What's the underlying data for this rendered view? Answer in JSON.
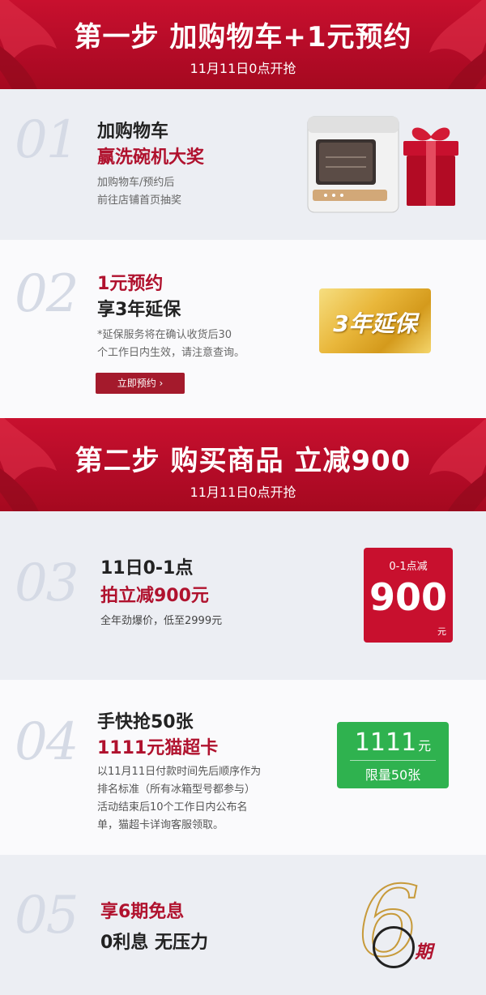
{
  "step1": {
    "title": "第一步  加购物车+1元预约",
    "subtitle": "11月11日0点开抢"
  },
  "item1": {
    "number": "01",
    "line1": "加购物车",
    "line2": "赢洗碗机大奖",
    "desc1": "加购物车/预约后",
    "desc2": "前往店铺首页抽奖"
  },
  "item2": {
    "number": "02",
    "line1": "1元预约",
    "line2": "享3年延保",
    "desc1": "*延保服务将在确认收货后30",
    "desc2": "个工作日内生效，请注意查询。",
    "button": "立即预约 ›",
    "card_text": "3年延保"
  },
  "step2": {
    "title": "第二步  购买商品  立减900",
    "subtitle": "11月11日0点开抢"
  },
  "item3": {
    "number": "03",
    "line1": "11日0-1点",
    "line2": "拍立减900元",
    "desc": "全年劲爆价，低至2999元",
    "box_top": "0-1点减",
    "box_value": "900",
    "box_unit": "元"
  },
  "item4": {
    "number": "04",
    "line1": "手快抢50张",
    "line2": "1111元猫超卡",
    "desc1": "以11月11日付款时间先后顺序作为",
    "desc2": "排名标准（所有冰箱型号都参与）",
    "desc3": "活动结束后10个工作日内公布名",
    "desc4": "单，猫超卡详询客服领取。",
    "box_value": "1111",
    "box_unit": "元",
    "box_bottom": "限量50张"
  },
  "item5": {
    "number": "05",
    "line1": "享6期免息",
    "line2": "0利息 无压力",
    "big_digit": "6",
    "period": "期"
  },
  "colors": {
    "brand_red": "#c8102e",
    "dark_red": "#a41a2c",
    "green": "#2fb24f",
    "gold": "#e9b73b"
  }
}
